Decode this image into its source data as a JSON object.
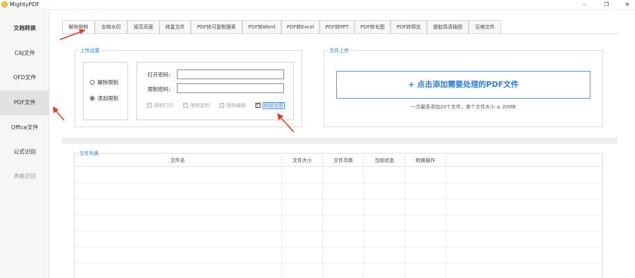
{
  "window": {
    "title": "MightyPDF",
    "minimize": "–",
    "maximize": "❐",
    "close": "✕"
  },
  "sidebar": {
    "items": [
      {
        "label": "文档转换"
      },
      {
        "label": "CAJ文件"
      },
      {
        "label": "OFD文件"
      },
      {
        "label": "PDF文件"
      },
      {
        "label": "Office文件"
      },
      {
        "label": "公式识别"
      },
      {
        "label": "表格识别"
      }
    ]
  },
  "tabs": [
    {
      "label": "解除限制"
    },
    {
      "label": "去除水印"
    },
    {
      "label": "规范页面"
    },
    {
      "label": "修复文件"
    },
    {
      "label": "PDF转可复制搜索"
    },
    {
      "label": "PDF转Word"
    },
    {
      "label": "PDF转Excel"
    },
    {
      "label": "PDF转PPT"
    },
    {
      "label": "PDF转长图"
    },
    {
      "label": "PDF转预览"
    },
    {
      "label": "提取高清插图"
    },
    {
      "label": "压缩文件"
    }
  ],
  "upload_settings": {
    "title": "上传设置",
    "radio_remove": "解除限制",
    "radio_add": "添加限制",
    "open_password_label": "打开密码：",
    "restrict_password_label": "限制密码：",
    "open_password_value": "",
    "restrict_password_value": "",
    "checks": [
      {
        "label": "限制打印"
      },
      {
        "label": "限制复制"
      },
      {
        "label": "限制编辑"
      },
      {
        "label": "超级加密"
      }
    ]
  },
  "file_upload": {
    "title": "文件上传",
    "button": "+ 点击添加需要处理的PDF文件",
    "hint": "一次最多添加20个文件，单个文件大小 ≤ 20MB"
  },
  "file_list": {
    "title": "文件列表",
    "columns": [
      "文件名",
      "文件大小",
      "文件页数",
      "当前状态",
      "转换操作"
    ]
  },
  "colors": {
    "accent": "#2d7fd3",
    "arrow": "#e03a2a"
  }
}
